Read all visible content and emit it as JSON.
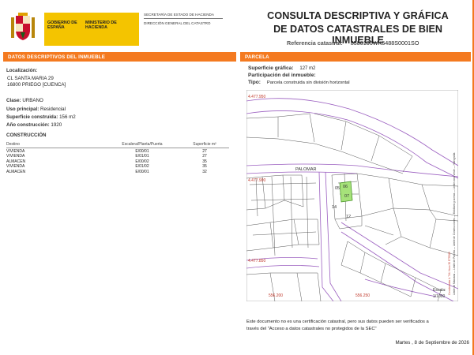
{
  "header": {
    "gobierno": "GOBIERNO DE ESPAÑA",
    "ministerio": "MINISTERIO DE HACIENDA",
    "secretaria": "SECRETARÍA DE ESTADO DE HACIENDA",
    "direccion": "DIRECCIÓN GENERAL DEL CATASTRO",
    "title_line1": "CONSULTA DESCRIPTIVA Y GRÁFICA",
    "title_line2": "DE DATOS CATASTRALES DE BIEN INMUEBLE",
    "ref_label": "Referencia catastral:",
    "ref_value": "8580106WK5488S0001SO"
  },
  "left": {
    "section_title": "DATOS DESCRIPTIVOS DEL INMUEBLE",
    "localizacion_label": "Localización:",
    "address1": "CL SANTA MARIA 29",
    "address2": "16800 PRIEGO [CUENCA]",
    "clase_label": "Clase:",
    "clase_value": "URBANO",
    "uso_label": "Uso principal:",
    "uso_value": "Residencial",
    "sup_label": "Superficie construida:",
    "sup_value": "156 m2",
    "anio_label": "Año construcción:",
    "anio_value": "1920",
    "construccion_title": "CONSTRUCCIÓN",
    "table_headers": [
      "Destino",
      "Escalera/Planta/Puerta",
      "Superficie m²"
    ],
    "rows": [
      [
        "VIVIENDA",
        "E/00/01",
        "27"
      ],
      [
        "VIVIENDA",
        "E/01/01",
        "27"
      ],
      [
        "ALMACEN",
        "E/00/02",
        "35"
      ],
      [
        "VIVIENDA",
        "E/01/02",
        "35"
      ],
      [
        "ALMACEN",
        "E/00/01",
        "32"
      ]
    ]
  },
  "right": {
    "section_title": "PARCELA",
    "sup_grafica_label": "Superficie gráfica:",
    "sup_grafica_value": "127 m2",
    "participacion_label": "Participación del inmueble:",
    "tipo_label": "Tipo:",
    "tipo_value": "Parcela construida sin división horizontal"
  },
  "map": {
    "coords": [
      "4.477.950",
      "4.477.900",
      "4.477.850",
      "556.200",
      "556.250"
    ],
    "street": "PALOMAR",
    "scale_label": "Escala:",
    "scale_value": "1/1000",
    "parcel_labels": [
      "06",
      "05",
      "07",
      "14",
      "12"
    ],
    "side_text": "Límite de Manzana  —  Límite de Parcela  —  Límite de Construcciones  —  Mobiliario y aceras  —  Límite zona verde  —  Hidrografía",
    "side_note": "Coordenadas U.T.M. Huso 30 ETRS89"
  },
  "footer": {
    "line1": "Este documento no es una certificación catastral, pero sus datos pueden ser verificados a",
    "line2": "través del \"Acceso a datos catastrales no protegidos de la SEC\"",
    "date": "Martes , 8 de Septiembre de 2026"
  },
  "colors": {
    "accent": "#f47a20",
    "brand_yellow": "#f4c400",
    "parcel_green": "#a6e27a",
    "map_purple": "#9b5fc0"
  }
}
